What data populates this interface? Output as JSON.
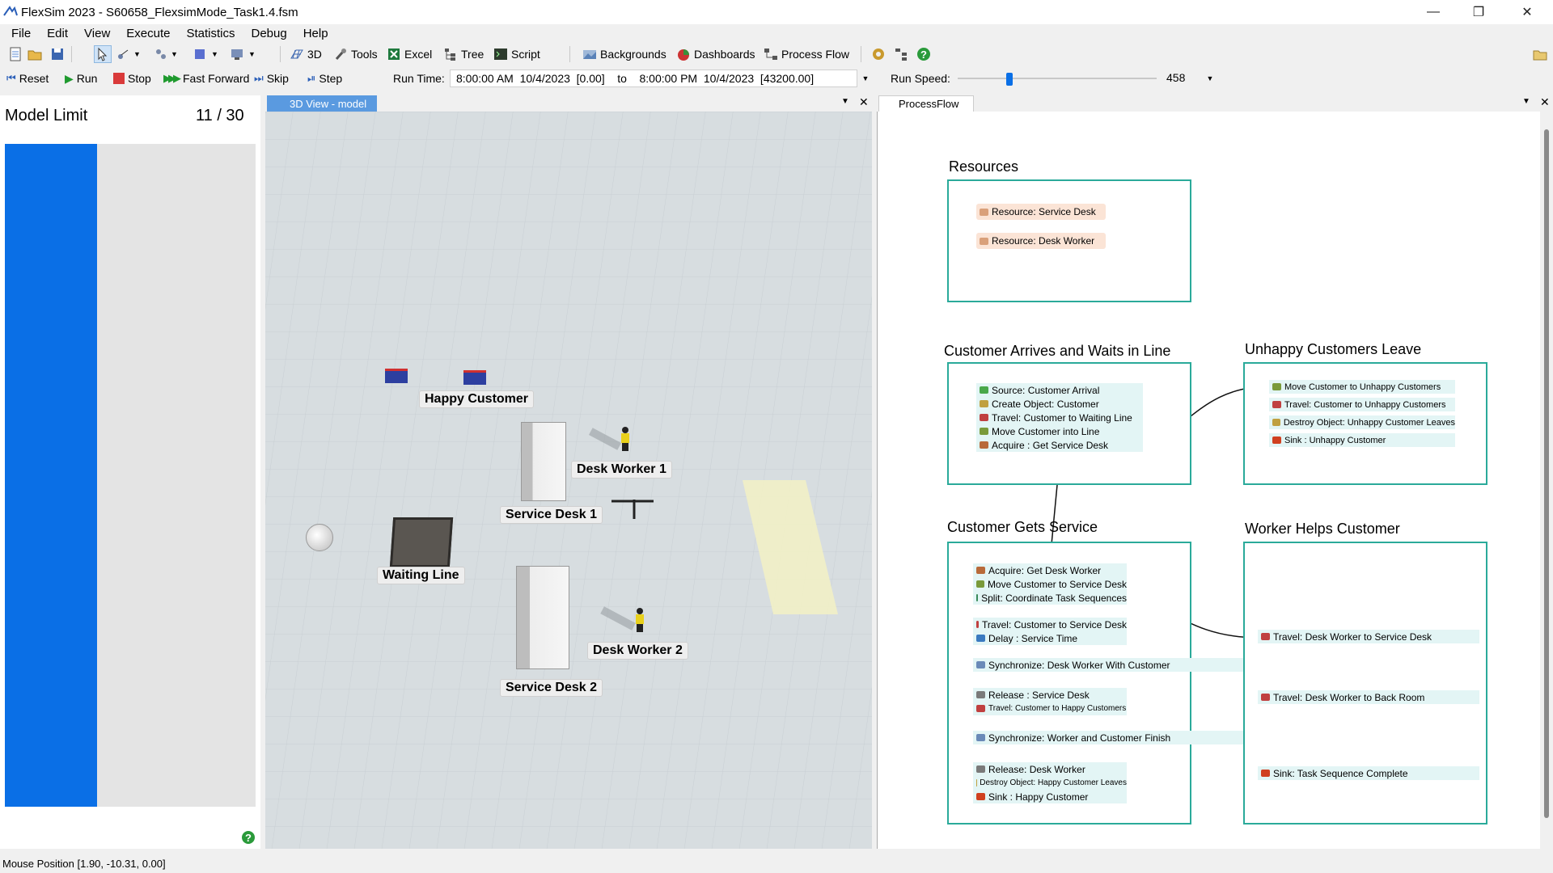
{
  "window": {
    "title": "FlexSim 2023 - S60658_FlexsimMode_Task1.4.fsm",
    "minimize": "—",
    "restore": "❐",
    "close": "✕"
  },
  "menu": [
    "File",
    "Edit",
    "View",
    "Execute",
    "Statistics",
    "Debug",
    "Help"
  ],
  "toolbar": {
    "view3d": "3D",
    "tools": "Tools",
    "excel": "Excel",
    "tree": "Tree",
    "script": "Script",
    "backgrounds": "Backgrounds",
    "dashboards": "Dashboards",
    "process_flow": "Process Flow"
  },
  "run_controls": {
    "reset": "Reset",
    "run": "Run",
    "stop": "Stop",
    "fast_forward": "Fast Forward",
    "skip": "Skip",
    "step": "Step",
    "run_time_label": "Run Time:",
    "run_time_value": "8:00:00 AM  10/4/2023  [0.00]    to    8:00:00 PM  10/4/2023  [43200.00]",
    "run_speed_label": "Run Speed:",
    "run_speed_value": "458",
    "run_speed_fraction": 0.25
  },
  "left_panel": {
    "title": "Model Limit",
    "count": "11 / 30",
    "fill_fraction": 0.367
  },
  "view3d": {
    "tab_label": "3D View - model",
    "labels": {
      "happy_customer": "Happy Customer",
      "desk_worker_1": "Desk Worker 1",
      "service_desk_1": "Service Desk 1",
      "waiting_line": "Waiting Line",
      "desk_worker_2": "Desk Worker 2",
      "service_desk_2": "Service Desk 2"
    }
  },
  "process_flow": {
    "tab_label": "ProcessFlow",
    "resources": {
      "title": "Resources",
      "items": [
        "Resource: Service Desk",
        "Resource: Desk Worker"
      ]
    },
    "arrives": {
      "title": "Customer Arrives and Waits in Line",
      "items": [
        "Source: Customer Arrival",
        "Create Object: Customer",
        "Travel: Customer to Waiting Line",
        "Move Customer into Line",
        "Acquire : Get Service Desk"
      ]
    },
    "unhappy": {
      "title": "Unhappy Customers Leave",
      "items": [
        "Move Customer to Unhappy Customers",
        "Travel: Customer to Unhappy Customers",
        "Destroy Object: Unhappy Customer Leaves",
        "Sink : Unhappy Customer"
      ]
    },
    "service": {
      "title": "Customer Gets Service",
      "block1": [
        "Acquire: Get Desk Worker",
        "Move Customer to Service Desk",
        "Split: Coordinate Task Sequences"
      ],
      "block2": [
        "Travel: Customer to Service Desk",
        "Delay : Service Time"
      ],
      "sync1": "Synchronize: Desk Worker With Customer",
      "block3": [
        "Release : Service Desk",
        "Travel: Customer to Happy Customers"
      ],
      "sync2": "Synchronize: Worker and Customer Finish",
      "block4": [
        "Release: Desk Worker",
        "Destroy Object: Happy Customer Leaves",
        "Sink : Happy Customer"
      ]
    },
    "worker": {
      "title": "Worker Helps Customer",
      "items": [
        "Travel: Desk Worker to Service Desk",
        "Travel: Desk Worker to Back Room",
        "Sink: Task Sequence Complete"
      ]
    }
  },
  "status_bar": "Mouse Position [1.90, -10.31, 0.00]",
  "colors": {
    "accent_blue": "#0a6fe6",
    "pf_border": "#2aaa9a",
    "activity_bg": "#e3f5f5",
    "resource_bg": "#fbe4d6",
    "floor": "#d7dde0"
  }
}
